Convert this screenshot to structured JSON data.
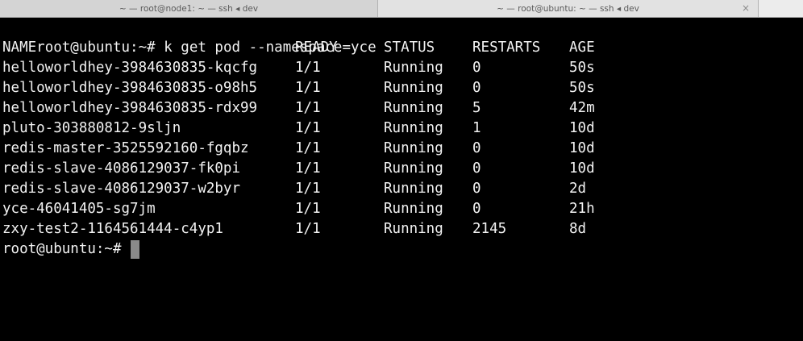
{
  "tabs": [
    {
      "title": "~ — root@node1: ~ — ssh ◂ dev"
    },
    {
      "title": "~ — root@ubuntu: ~ — ssh ◂ dev",
      "close": "×"
    }
  ],
  "terminal": {
    "prompt": "root@ubuntu:~#",
    "command": "k get pod --namespace=yce",
    "headers": [
      "NAME",
      "READY",
      "STATUS",
      "RESTARTS",
      "AGE"
    ],
    "rows": [
      [
        "helloworldhey-3984630835-kqcfg",
        "1/1",
        "Running",
        "0",
        "50s"
      ],
      [
        "helloworldhey-3984630835-o98h5",
        "1/1",
        "Running",
        "0",
        "50s"
      ],
      [
        "helloworldhey-3984630835-rdx99",
        "1/1",
        "Running",
        "5",
        "42m"
      ],
      [
        "pluto-303880812-9sljn",
        "1/1",
        "Running",
        "1",
        "10d"
      ],
      [
        "redis-master-3525592160-fgqbz",
        "1/1",
        "Running",
        "0",
        "10d"
      ],
      [
        "redis-slave-4086129037-fk0pi",
        "1/1",
        "Running",
        "0",
        "10d"
      ],
      [
        "redis-slave-4086129037-w2byr",
        "1/1",
        "Running",
        "0",
        "2d"
      ],
      [
        "yce-46041405-sg7jm",
        "1/1",
        "Running",
        "0",
        "21h"
      ],
      [
        "zxy-test2-1164561444-c4yp1",
        "1/1",
        "Running",
        "2145",
        "8d"
      ]
    ]
  }
}
